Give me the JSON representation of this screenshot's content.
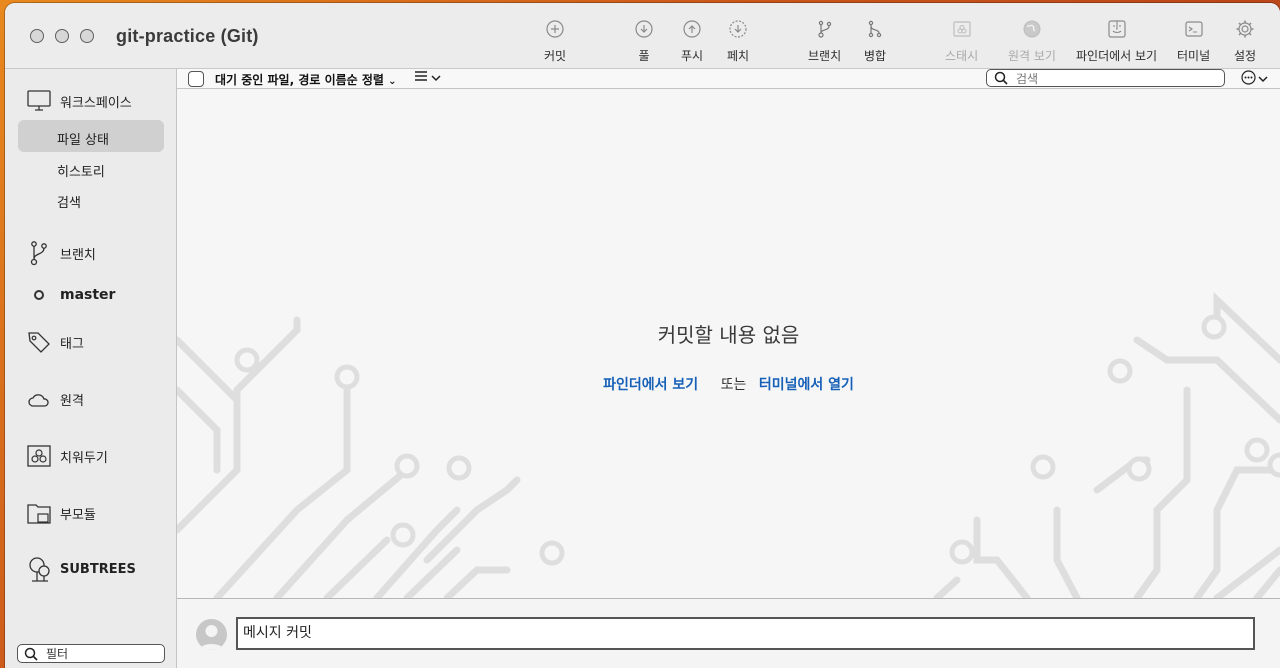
{
  "window": {
    "title": "git-practice (Git)"
  },
  "toolbar": {
    "commit": "커밋",
    "pull": "풀",
    "push": "푸시",
    "fetch": "페치",
    "branch": "브랜치",
    "merge": "병합",
    "stash": "스태시",
    "remote_view": "원격 보기",
    "show_in_finder": "파인더에서 보기",
    "terminal": "터미널",
    "settings": "설정"
  },
  "sidebar": {
    "workspace": "워크스페이스",
    "file_status": "파일 상태",
    "history": "히스토리",
    "search": "검색",
    "branches": "브랜치",
    "current_branch": "master",
    "tags": "태그",
    "remotes": "원격",
    "stashes": "치워두기",
    "submodules": "부모듈",
    "subtrees": "SUBTREES",
    "filter_placeholder": "필터"
  },
  "filterbar": {
    "label": "대기 중인 파일, 경로 이름순 정렬",
    "search_placeholder": "검색"
  },
  "empty_state": {
    "title": "커밋할 내용 없음",
    "show_in_finder": "파인더에서 보기",
    "or": "또는",
    "open_in_terminal": "터미널에서 열기"
  },
  "commit": {
    "message_placeholder": "메시지 커밋"
  },
  "colors": {
    "accent_link": "#1660b8",
    "circuit": "#dcdcdc"
  }
}
